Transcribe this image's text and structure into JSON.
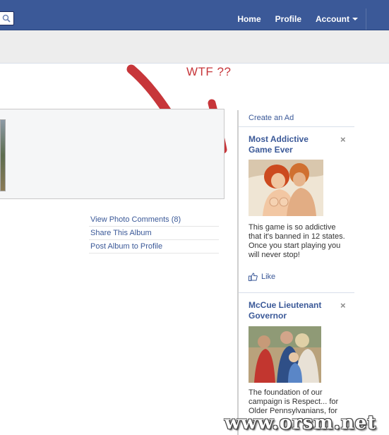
{
  "topbar": {
    "nav": [
      {
        "label": "Home"
      },
      {
        "label": "Profile"
      },
      {
        "label": "Account"
      }
    ]
  },
  "annotation": {
    "text": "WTF ??",
    "arrow_color": "#c7363a"
  },
  "album_links": [
    {
      "label": "View Photo Comments (8)"
    },
    {
      "label": "Share This Album"
    },
    {
      "label": "Post Album to Profile"
    }
  ],
  "sidebar": {
    "create_ad": "Create an Ad",
    "ads": [
      {
        "title": "Most Addictive Game Ever",
        "body": "This game is so addictive that it's banned in 12 states. Once you start playing you will never stop!",
        "like_label": "Like",
        "close": "×"
      },
      {
        "title": "McCue Lieutenant Governor",
        "body": "The foundation of our campaign is Respect... for Older Pennsylvanians, for",
        "close": "×"
      }
    ]
  },
  "watermark": "www.orsm.net",
  "colors": {
    "brand": "#3b5998",
    "annotation": "#c7363a"
  }
}
